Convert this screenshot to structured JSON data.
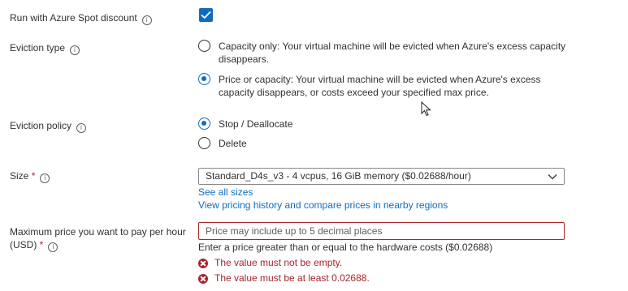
{
  "spot": {
    "label": "Run with Azure Spot discount",
    "checked": true
  },
  "eviction_type": {
    "label": "Eviction type",
    "options": [
      {
        "text": "Capacity only: Your virtual machine will be evicted when Azure's excess capacity disappears.",
        "selected": false
      },
      {
        "text": "Price or capacity: Your virtual machine will be evicted when Azure's excess capacity disappears, or costs exceed your specified max price.",
        "selected": true
      }
    ]
  },
  "eviction_policy": {
    "label": "Eviction policy",
    "options": [
      {
        "text": "Stop / Deallocate",
        "selected": true
      },
      {
        "text": "Delete",
        "selected": false
      }
    ]
  },
  "size": {
    "label": "Size",
    "required_marker": "*",
    "value": "Standard_D4s_v3 - 4 vcpus, 16 GiB memory ($0.02688/hour)",
    "links": [
      "See all sizes",
      "View pricing history and compare prices in nearby regions"
    ]
  },
  "max_price": {
    "label_line1": "Maximum price you want to pay per hour",
    "label_line2": "(USD)",
    "required_marker": "*",
    "placeholder": "Price may include up to 5 decimal places",
    "value": "",
    "hint": "Enter a price greater than or equal to the hardware costs ($0.02688)",
    "errors": [
      "The value must not be empty.",
      "The value must be at least 0.02688."
    ]
  },
  "colors": {
    "accent": "#0f6cbd",
    "error": "#a4262c",
    "text": "#323130"
  }
}
